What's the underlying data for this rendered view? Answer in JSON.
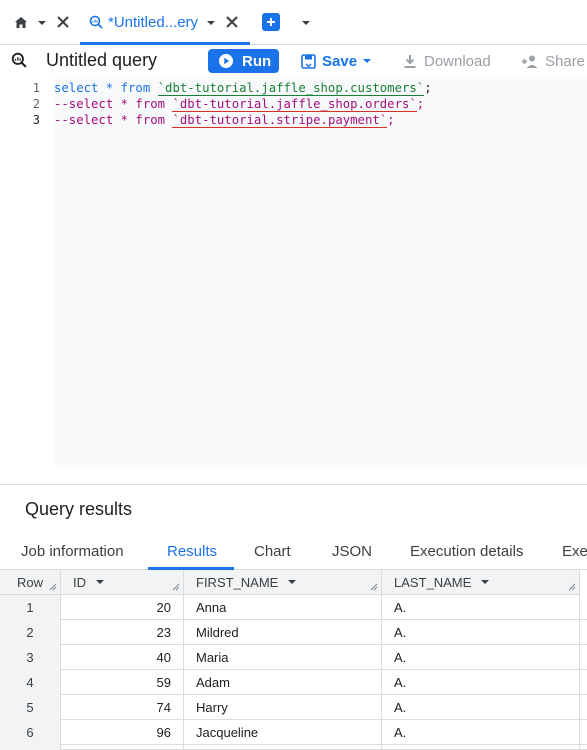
{
  "tabs": {
    "query_tab_title": "*Untitled...ery"
  },
  "toolbar": {
    "title": "Untitled query",
    "run_label": "Run",
    "save_label": "Save",
    "download_label": "Download",
    "share_label": "Share"
  },
  "editor": {
    "lines": [
      {
        "num": "1",
        "prefix": "select * from ",
        "ref": "`dbt-tutorial.jaffle_shop.customers`",
        "suffix": ";"
      },
      {
        "num": "2",
        "prefix": "--select * from ",
        "ref": "`dbt-tutorial.jaffle_shop.orders`",
        "suffix": ";"
      },
      {
        "num": "3",
        "prefix": "--select * from ",
        "ref": "`dbt-tutorial.stripe.payment`",
        "suffix": ";"
      }
    ]
  },
  "results": {
    "title": "Query results",
    "tabs": [
      "Job information",
      "Results",
      "Chart",
      "JSON",
      "Execution details",
      "Exec"
    ],
    "active_tab": "Results",
    "columns": [
      "Row",
      "ID",
      "FIRST_NAME",
      "LAST_NAME"
    ],
    "rows": [
      {
        "row": "1",
        "id": "20",
        "first_name": "Anna",
        "last_name": "A."
      },
      {
        "row": "2",
        "id": "23",
        "first_name": "Mildred",
        "last_name": "A."
      },
      {
        "row": "3",
        "id": "40",
        "first_name": "Maria",
        "last_name": "A."
      },
      {
        "row": "4",
        "id": "59",
        "first_name": "Adam",
        "last_name": "A."
      },
      {
        "row": "5",
        "id": "74",
        "first_name": "Harry",
        "last_name": "A."
      },
      {
        "row": "6",
        "id": "96",
        "first_name": "Jacqueline",
        "last_name": "A."
      }
    ]
  },
  "colors": {
    "accent": "#1a73e8",
    "keyword": "#1a73e8",
    "comment": "#a50e7e",
    "string": "#188038"
  }
}
